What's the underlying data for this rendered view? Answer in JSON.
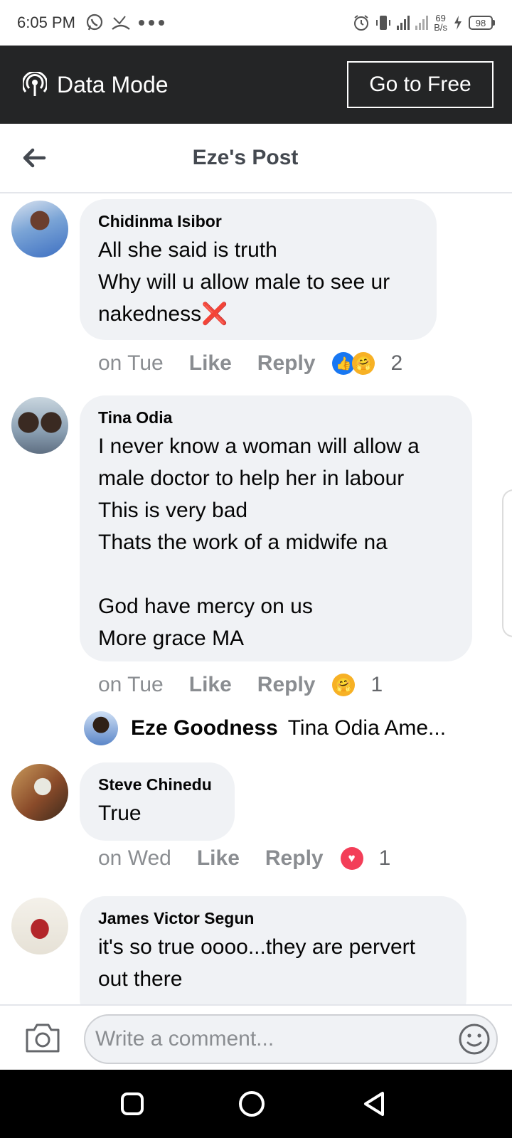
{
  "status_bar": {
    "time": "6:05 PM",
    "speed_value": "69",
    "speed_unit": "B/s",
    "battery": "98",
    "icons": [
      "whatsapp-icon",
      "missed-call-icon",
      "more-dots-icon",
      "alarm-icon",
      "vibrate-icon",
      "signal-icon",
      "charging-icon",
      "battery-icon"
    ]
  },
  "data_mode": {
    "title": "Data Mode",
    "button_label": "Go to Free"
  },
  "header": {
    "title": "Eze's Post"
  },
  "comments": [
    {
      "author": "Chidinma Isibor",
      "text": "All she said is truth\nWhy will u allow male to see ur nakedness❌",
      "time": "on Tue",
      "like_label": "Like",
      "reply_label": "Reply",
      "reactions": [
        "like",
        "care"
      ],
      "reaction_count": "2"
    },
    {
      "author": "Tina Odia",
      "text": "I never know a woman will allow a male doctor to help her in labour\nThis is very bad\nThats the work of a midwife na\n\nGod have mercy on us\nMore grace MA",
      "time": "on Tue",
      "like_label": "Like",
      "reply_label": "Reply",
      "reactions": [
        "care"
      ],
      "reaction_count": "1",
      "reply_preview": {
        "author": "Eze Goodness",
        "text": "Tina Odia Ame..."
      }
    },
    {
      "author": "Steve Chinedu",
      "text": "True",
      "time": "on Wed",
      "like_label": "Like",
      "reply_label": "Reply",
      "reactions": [
        "love"
      ],
      "reaction_count": "1"
    },
    {
      "author": "James Victor Segun",
      "text": "it's so true oooo...they are pervert out there"
    }
  ],
  "composer": {
    "placeholder": "Write a comment..."
  },
  "colors": {
    "accent_blue": "#1877f2",
    "love_red": "#f33e58",
    "bubble_gray": "#f0f2f5",
    "dark_bar": "#242526"
  }
}
